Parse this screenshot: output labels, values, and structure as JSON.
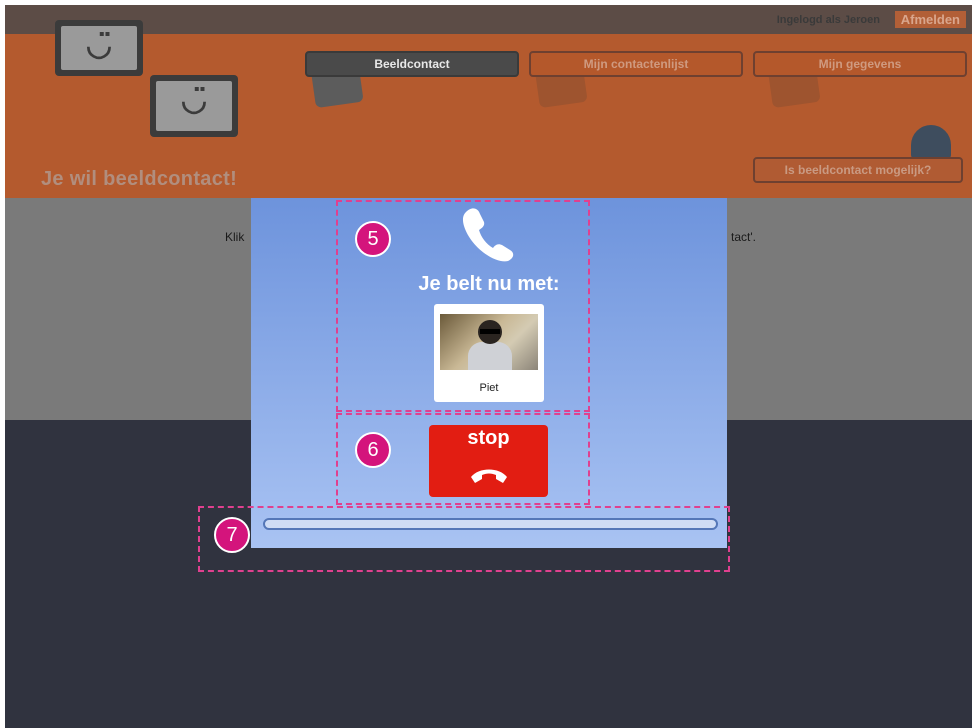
{
  "header": {
    "logged_in": "Ingelogd als Jeroen",
    "logout": "Afmelden",
    "page_title": "Je wil beeldcontact!",
    "check_button": "Is beeldcontact mogelijk?"
  },
  "nav": {
    "video_contact": "Beeldcontact",
    "contacts": "Mijn contactenlijst",
    "profile": "Mijn gegevens"
  },
  "content": {
    "instruction_left": "Klik",
    "instruction_right": "tact'."
  },
  "dialog": {
    "calling_text": "Je belt nu met:",
    "contact_name": "Piet",
    "stop_label": "stop",
    "progress": 0
  },
  "annotations": {
    "badge_5": "5",
    "badge_6": "6",
    "badge_7": "7",
    "color": "#e0408f"
  },
  "colors": {
    "header": "#b45a2e",
    "dialog_top": "#6d93dc",
    "dialog_bottom": "#a9c3f3",
    "stop": "#e21d12"
  }
}
